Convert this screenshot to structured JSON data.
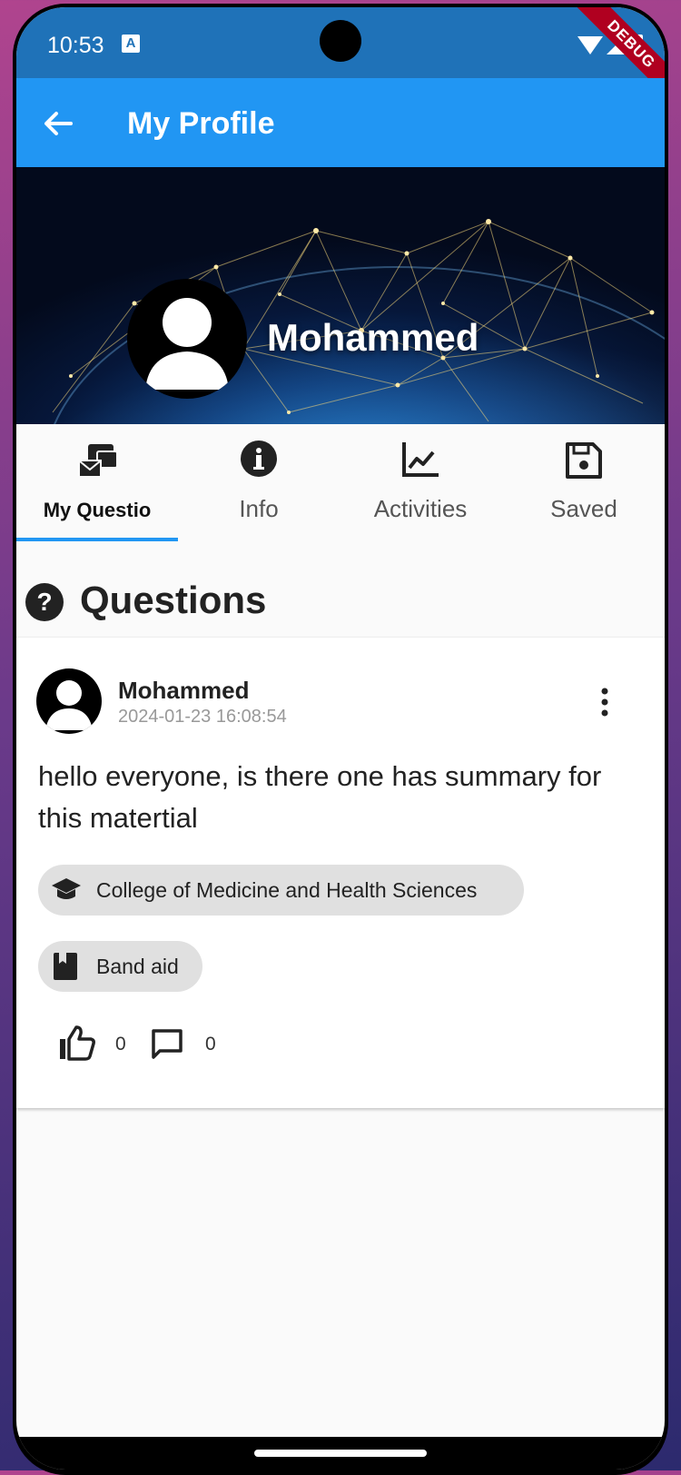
{
  "status_bar": {
    "time": "10:53",
    "notification_icon": "A",
    "debug_label": "DEBUG"
  },
  "app_bar": {
    "title": "My Profile",
    "back_icon": "arrow-left-icon"
  },
  "profile": {
    "name": "Mohammed"
  },
  "tabs": [
    {
      "label": "My Questio",
      "icon": "mail-stack-icon",
      "active": true
    },
    {
      "label": "Info",
      "icon": "info-icon",
      "active": false
    },
    {
      "label": "Activities",
      "icon": "chart-line-icon",
      "active": false
    },
    {
      "label": "Saved",
      "icon": "save-icon",
      "active": false
    }
  ],
  "section": {
    "title": "Questions",
    "icon": "question-circle-icon"
  },
  "question": {
    "author": "Mohammed",
    "timestamp": "2024-01-23 16:08:54",
    "body": "hello everyone, is there one has summary for this matertial",
    "college_tag": "College of Medicine and Health Sciences",
    "subject_tag": "Band aid",
    "likes": "0",
    "comments": "0"
  },
  "colors": {
    "app_bar": "#2196f3",
    "status_bar": "#1f72b8",
    "tab_indicator": "#2196f3",
    "chip_bg": "#e0e0e0"
  }
}
